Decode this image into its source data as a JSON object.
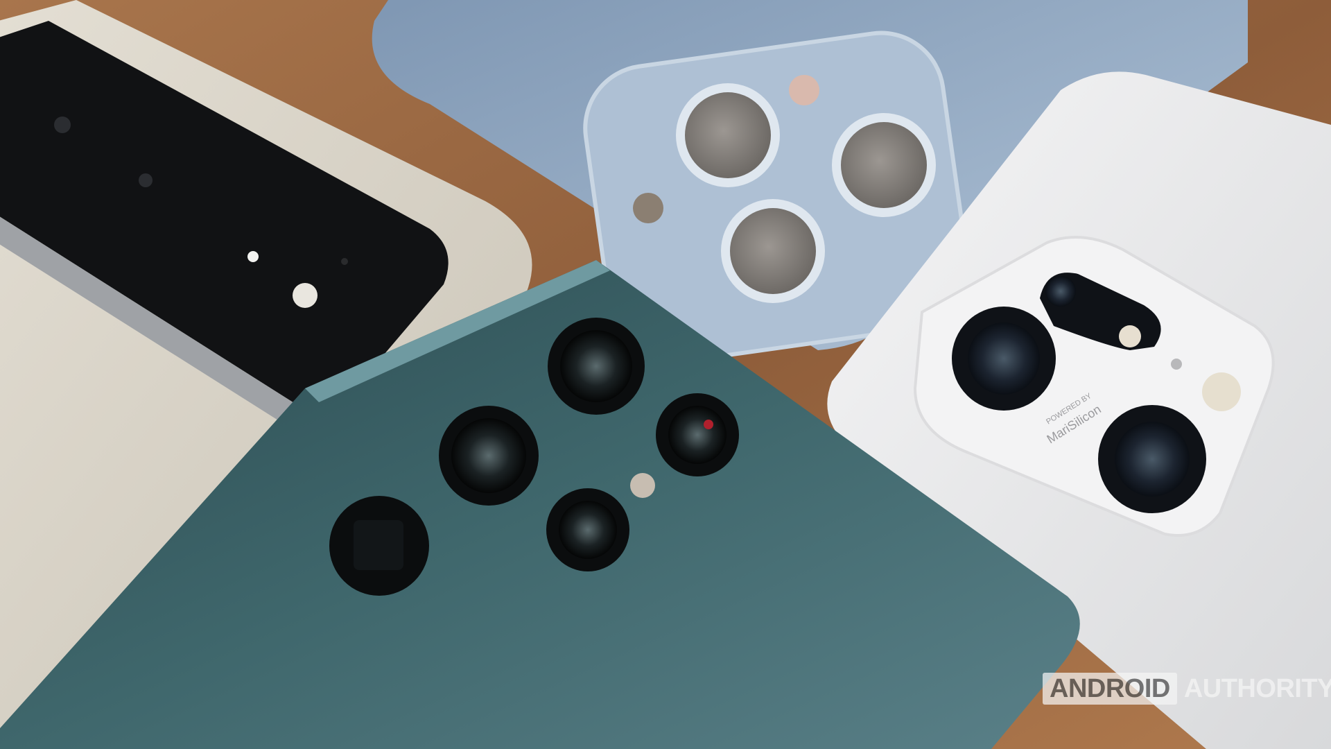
{
  "image": {
    "description_tag": "natural-photo",
    "palette": {
      "table": "#9a6a45",
      "pixel": "#d7d1c4",
      "pixel_bar": "#111214",
      "iphone": "#8fa6c0",
      "galaxy": "#3d6368",
      "oppo": "#e9e9ea"
    }
  },
  "phone_text": {
    "powered_by": "POWERED BY",
    "mari_silicon": "MariSilicon"
  },
  "watermark": {
    "boxed": "ANDROID",
    "plain": "AUTHORITY"
  }
}
